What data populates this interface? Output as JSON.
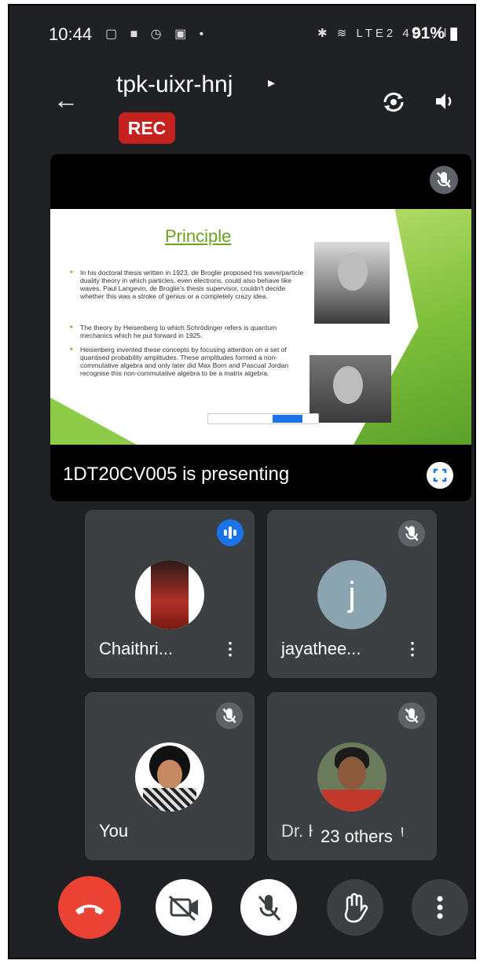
{
  "status_bar": {
    "time": "10:44",
    "left_icons": "▢ ■ ◷ ▣ •",
    "right_icons": "✱ ≋ LTE2 4G .ıl",
    "battery": "91%"
  },
  "header": {
    "meeting_code": "tpk-uixr-hnj",
    "rec_badge": "REC"
  },
  "presentation": {
    "slide": {
      "title": "Principle",
      "bullets": [
        "In his doctoral thesis written in 1923, de Broglie proposed his wave/particle duality theory in which particles, even electrons, could also behave like waves. Paul Langevin, de Broglie's thesis supervisor, couldn't decide whether this was a stroke of genius or a completely crazy idea.",
        "The theory by Heisenberg to which Schrödinger refers is quantum mechanics which he put forward in 1925.",
        "Heisenberg invented these concepts by focusing attention on a set of quantised probability amplitudes. These amplitudes formed a non-commutative algebra and only later did Max Born and Pascual Jordan recognise this non-commutative algebra to be a matrix algebra."
      ]
    },
    "presenter_label": "1DT20CV005 is presenting"
  },
  "participants": [
    {
      "name": "Chaithri...",
      "state": "speaking"
    },
    {
      "name": "jayathee...",
      "initial": "j",
      "state": "muted"
    },
    {
      "name": "You",
      "state": "muted"
    },
    {
      "name": "Dr. H. S. Madhu",
      "state": "muted",
      "overlay": "23 others"
    }
  ],
  "colors": {
    "background": "#202124",
    "tile": "#3c4043",
    "rec": "#c5221f",
    "end_call": "#ea4335",
    "accent": "#1a73e8",
    "slide_green": "#7fbf3b"
  }
}
